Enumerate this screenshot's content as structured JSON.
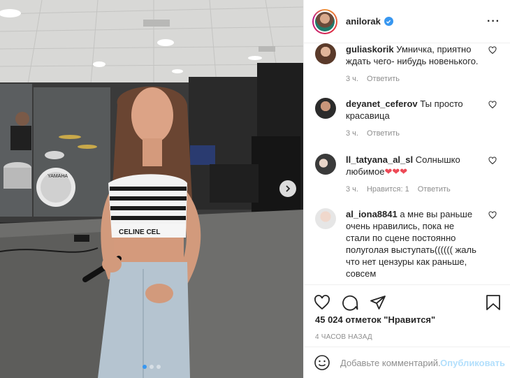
{
  "post": {
    "username": "anilorak",
    "likes_text": "45 024 отметок \"Нравится\"",
    "time_text": "4 ЧАСОВ НАЗАД"
  },
  "comments": [
    {
      "user": "guliaskorik",
      "text": "Умничка, приятно ждать чего- нибудь новенького.",
      "age": "3 ч.",
      "reply": "Ответить",
      "likes": ""
    },
    {
      "user": "deyanet_ceferov",
      "text": "Ты просто красавица",
      "age": "3 ч.",
      "reply": "Ответить",
      "likes": ""
    },
    {
      "user": "ll_tatyana_al_sl",
      "text": "Солнышко любимое",
      "hearts": "❤❤❤",
      "age": "3 ч.",
      "likes": "Нравится: 1",
      "reply": "Ответить"
    },
    {
      "user": "al_iona8841",
      "text": "а мне вы раньше очень нравились, пока не стали по сцене постоянно полуголая выступать(((((( жаль что нет цензуры как раньше, совсем",
      "age": "",
      "reply": "",
      "likes": ""
    }
  ],
  "add_comment": {
    "placeholder": "Добавьте комментарий...",
    "publish_label": "Опубликовать"
  },
  "colors": {
    "accent": "#3897f0",
    "muted": "#8e8e8e",
    "publish_disabled": "#b2dffc",
    "heart_red": "#ed4956"
  },
  "icons": {
    "header": [
      "verified-badge-icon",
      "more-options-icon"
    ],
    "actions": [
      "heart-icon",
      "comment-icon",
      "share-icon",
      "bookmark-icon"
    ],
    "photo": [
      "next-arrow-icon"
    ],
    "composer": [
      "emoji-icon"
    ]
  },
  "carousel": {
    "current": 1,
    "total": 3
  }
}
